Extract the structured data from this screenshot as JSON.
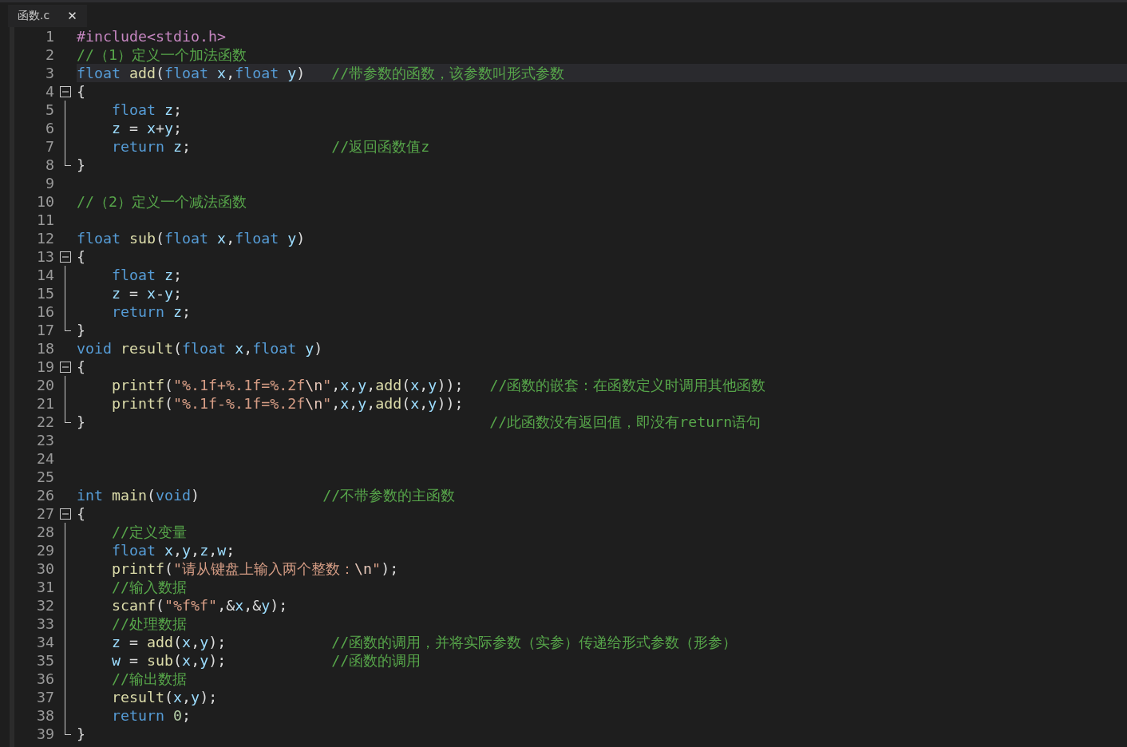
{
  "tab": {
    "title": "函数.c",
    "close": "✕"
  },
  "lines": [
    {
      "number": "1",
      "kind": "plain",
      "current": false,
      "tokens": [
        {
          "kind": "preproc",
          "text": "#include<stdio.h>"
        }
      ]
    },
    {
      "number": "2",
      "kind": "plain",
      "current": false,
      "tokens": [
        {
          "kind": "comment",
          "text": "//（1）定义一个加法函数"
        }
      ]
    },
    {
      "number": "3",
      "kind": "plain",
      "current": true,
      "tokens": [
        {
          "kind": "keyword",
          "text": "float"
        },
        {
          "kind": "func",
          "text": " add"
        },
        {
          "kind": "plain",
          "text": "("
        },
        {
          "kind": "keyword",
          "text": "float"
        },
        {
          "kind": "ident",
          "text": " x"
        },
        {
          "kind": "plain",
          "text": ","
        },
        {
          "kind": "keyword",
          "text": "float"
        },
        {
          "kind": "ident",
          "text": " y"
        },
        {
          "kind": "plain",
          "text": ")"
        },
        {
          "kind": "comment",
          "text": "   //带参数的函数，该参数叫形式参数"
        }
      ]
    },
    {
      "number": "4",
      "kind": "start",
      "current": false,
      "tokens": [
        {
          "kind": "plain",
          "text": "{"
        }
      ]
    },
    {
      "number": "5",
      "kind": "inner",
      "current": false,
      "tokens": [
        {
          "kind": "keyword",
          "text": "    float"
        },
        {
          "kind": "ident",
          "text": " z"
        },
        {
          "kind": "plain",
          "text": ";"
        }
      ]
    },
    {
      "number": "6",
      "kind": "inner",
      "current": false,
      "tokens": [
        {
          "kind": "ident",
          "text": "    z"
        },
        {
          "kind": "plain",
          "text": " = "
        },
        {
          "kind": "ident",
          "text": "x"
        },
        {
          "kind": "plain",
          "text": "+"
        },
        {
          "kind": "ident",
          "text": "y"
        },
        {
          "kind": "plain",
          "text": ";"
        }
      ]
    },
    {
      "number": "7",
      "kind": "inner",
      "current": false,
      "tokens": [
        {
          "kind": "keyword",
          "text": "    return"
        },
        {
          "kind": "ident",
          "text": " z"
        },
        {
          "kind": "plain",
          "text": ";"
        },
        {
          "kind": "comment",
          "text": "                //返回函数值z"
        }
      ]
    },
    {
      "number": "8",
      "kind": "end",
      "current": false,
      "tokens": [
        {
          "kind": "plain",
          "text": "}"
        }
      ]
    },
    {
      "number": "9",
      "kind": "plain",
      "current": false
    },
    {
      "number": "10",
      "kind": "plain",
      "current": false,
      "tokens": [
        {
          "kind": "comment",
          "text": "//（2）定义一个减法函数"
        }
      ]
    },
    {
      "number": "11",
      "kind": "plain",
      "current": false
    },
    {
      "number": "12",
      "kind": "plain",
      "current": false,
      "tokens": [
        {
          "kind": "keyword",
          "text": "float"
        },
        {
          "kind": "func",
          "text": " sub"
        },
        {
          "kind": "plain",
          "text": "("
        },
        {
          "kind": "keyword",
          "text": "float"
        },
        {
          "kind": "ident",
          "text": " x"
        },
        {
          "kind": "plain",
          "text": ","
        },
        {
          "kind": "keyword",
          "text": "float"
        },
        {
          "kind": "ident",
          "text": " y"
        },
        {
          "kind": "plain",
          "text": ")"
        }
      ]
    },
    {
      "number": "13",
      "kind": "start",
      "current": false,
      "tokens": [
        {
          "kind": "plain",
          "text": "{"
        }
      ]
    },
    {
      "number": "14",
      "kind": "inner",
      "current": false,
      "tokens": [
        {
          "kind": "keyword",
          "text": "    float"
        },
        {
          "kind": "ident",
          "text": " z"
        },
        {
          "kind": "plain",
          "text": ";"
        }
      ]
    },
    {
      "number": "15",
      "kind": "inner",
      "current": false,
      "tokens": [
        {
          "kind": "ident",
          "text": "    z"
        },
        {
          "kind": "plain",
          "text": " = "
        },
        {
          "kind": "ident",
          "text": "x"
        },
        {
          "kind": "plain",
          "text": "-"
        },
        {
          "kind": "ident",
          "text": "y"
        },
        {
          "kind": "plain",
          "text": ";"
        }
      ]
    },
    {
      "number": "16",
      "kind": "inner",
      "current": false,
      "tokens": [
        {
          "kind": "keyword",
          "text": "    return"
        },
        {
          "kind": "ident",
          "text": " z"
        },
        {
          "kind": "plain",
          "text": ";"
        }
      ]
    },
    {
      "number": "17",
      "kind": "end",
      "current": false,
      "tokens": [
        {
          "kind": "plain",
          "text": "}"
        }
      ]
    },
    {
      "number": "18",
      "kind": "plain",
      "current": false,
      "tokens": [
        {
          "kind": "keyword",
          "text": "void"
        },
        {
          "kind": "func",
          "text": " result"
        },
        {
          "kind": "plain",
          "text": "("
        },
        {
          "kind": "keyword",
          "text": "float"
        },
        {
          "kind": "ident",
          "text": " x"
        },
        {
          "kind": "plain",
          "text": ","
        },
        {
          "kind": "keyword",
          "text": "float"
        },
        {
          "kind": "ident",
          "text": " y"
        },
        {
          "kind": "plain",
          "text": ")"
        }
      ]
    },
    {
      "number": "19",
      "kind": "start",
      "current": false,
      "tokens": [
        {
          "kind": "plain",
          "text": "{"
        }
      ]
    },
    {
      "number": "20",
      "kind": "inner",
      "current": false,
      "tokens": [
        {
          "kind": "func",
          "text": "    printf"
        },
        {
          "kind": "plain",
          "text": "("
        },
        {
          "kind": "string",
          "text": "\"%.1f+%.1f=%.2f"
        },
        {
          "kind": "escape",
          "text": "\\n"
        },
        {
          "kind": "string",
          "text": "\""
        },
        {
          "kind": "plain",
          "text": ","
        },
        {
          "kind": "ident",
          "text": "x"
        },
        {
          "kind": "plain",
          "text": ","
        },
        {
          "kind": "ident",
          "text": "y"
        },
        {
          "kind": "plain",
          "text": ","
        },
        {
          "kind": "func",
          "text": "add"
        },
        {
          "kind": "plain",
          "text": "("
        },
        {
          "kind": "ident",
          "text": "x"
        },
        {
          "kind": "plain",
          "text": ","
        },
        {
          "kind": "ident",
          "text": "y"
        },
        {
          "kind": "plain",
          "text": "));"
        },
        {
          "kind": "comment",
          "text": "   //函数的嵌套：在函数定义时调用其他函数"
        }
      ]
    },
    {
      "number": "21",
      "kind": "inner",
      "current": false,
      "tokens": [
        {
          "kind": "func",
          "text": "    printf"
        },
        {
          "kind": "plain",
          "text": "("
        },
        {
          "kind": "string",
          "text": "\"%.1f-%.1f=%.2f"
        },
        {
          "kind": "escape",
          "text": "\\n"
        },
        {
          "kind": "string",
          "text": "\""
        },
        {
          "kind": "plain",
          "text": ","
        },
        {
          "kind": "ident",
          "text": "x"
        },
        {
          "kind": "plain",
          "text": ","
        },
        {
          "kind": "ident",
          "text": "y"
        },
        {
          "kind": "plain",
          "text": ","
        },
        {
          "kind": "func",
          "text": "add"
        },
        {
          "kind": "plain",
          "text": "("
        },
        {
          "kind": "ident",
          "text": "x"
        },
        {
          "kind": "plain",
          "text": ","
        },
        {
          "kind": "ident",
          "text": "y"
        },
        {
          "kind": "plain",
          "text": "));"
        }
      ]
    },
    {
      "number": "22",
      "kind": "end",
      "current": false,
      "tokens": [
        {
          "kind": "plain",
          "text": "}"
        },
        {
          "kind": "comment",
          "text": "                                              //此函数没有返回值，即没有return语句"
        }
      ]
    },
    {
      "number": "23",
      "kind": "plain",
      "current": false
    },
    {
      "number": "24",
      "kind": "plain",
      "current": false
    },
    {
      "number": "25",
      "kind": "plain",
      "current": false
    },
    {
      "number": "26",
      "kind": "plain",
      "current": false,
      "tokens": [
        {
          "kind": "keyword",
          "text": "int"
        },
        {
          "kind": "func",
          "text": " main"
        },
        {
          "kind": "plain",
          "text": "("
        },
        {
          "kind": "keyword",
          "text": "void"
        },
        {
          "kind": "plain",
          "text": ")"
        },
        {
          "kind": "comment",
          "text": "              //不带参数的主函数"
        }
      ]
    },
    {
      "number": "27",
      "kind": "start",
      "current": false,
      "tokens": [
        {
          "kind": "plain",
          "text": "{"
        }
      ]
    },
    {
      "number": "28",
      "kind": "inner",
      "current": false,
      "tokens": [
        {
          "kind": "comment",
          "text": "    //定义变量"
        }
      ]
    },
    {
      "number": "29",
      "kind": "inner",
      "current": false,
      "tokens": [
        {
          "kind": "keyword",
          "text": "    float"
        },
        {
          "kind": "ident",
          "text": " x"
        },
        {
          "kind": "plain",
          "text": ","
        },
        {
          "kind": "ident",
          "text": "y"
        },
        {
          "kind": "plain",
          "text": ","
        },
        {
          "kind": "ident",
          "text": "z"
        },
        {
          "kind": "plain",
          "text": ","
        },
        {
          "kind": "ident",
          "text": "w"
        },
        {
          "kind": "plain",
          "text": ";"
        }
      ]
    },
    {
      "number": "30",
      "kind": "inner",
      "current": false,
      "tokens": [
        {
          "kind": "func",
          "text": "    printf"
        },
        {
          "kind": "plain",
          "text": "("
        },
        {
          "kind": "string",
          "text": "\"请从键盘上输入两个整数："
        },
        {
          "kind": "escape",
          "text": "\\n"
        },
        {
          "kind": "string",
          "text": "\""
        },
        {
          "kind": "plain",
          "text": ");"
        }
      ]
    },
    {
      "number": "31",
      "kind": "inner",
      "current": false,
      "tokens": [
        {
          "kind": "comment",
          "text": "    //输入数据"
        }
      ]
    },
    {
      "number": "32",
      "kind": "inner",
      "current": false,
      "tokens": [
        {
          "kind": "func",
          "text": "    scanf"
        },
        {
          "kind": "plain",
          "text": "("
        },
        {
          "kind": "string",
          "text": "\"%f%f\""
        },
        {
          "kind": "plain",
          "text": ",&"
        },
        {
          "kind": "ident",
          "text": "x"
        },
        {
          "kind": "plain",
          "text": ",&"
        },
        {
          "kind": "ident",
          "text": "y"
        },
        {
          "kind": "plain",
          "text": ");"
        }
      ]
    },
    {
      "number": "33",
      "kind": "inner",
      "current": false,
      "tokens": [
        {
          "kind": "comment",
          "text": "    //处理数据"
        }
      ]
    },
    {
      "number": "34",
      "kind": "inner",
      "current": false,
      "tokens": [
        {
          "kind": "ident",
          "text": "    z"
        },
        {
          "kind": "plain",
          "text": " = "
        },
        {
          "kind": "func",
          "text": "add"
        },
        {
          "kind": "plain",
          "text": "("
        },
        {
          "kind": "ident",
          "text": "x"
        },
        {
          "kind": "plain",
          "text": ","
        },
        {
          "kind": "ident",
          "text": "y"
        },
        {
          "kind": "plain",
          "text": ");"
        },
        {
          "kind": "comment",
          "text": "            //函数的调用，并将实际参数（实参）传递给形式参数（形参）"
        }
      ]
    },
    {
      "number": "35",
      "kind": "inner",
      "current": false,
      "tokens": [
        {
          "kind": "ident",
          "text": "    w"
        },
        {
          "kind": "plain",
          "text": " = "
        },
        {
          "kind": "func",
          "text": "sub"
        },
        {
          "kind": "plain",
          "text": "("
        },
        {
          "kind": "ident",
          "text": "x"
        },
        {
          "kind": "plain",
          "text": ","
        },
        {
          "kind": "ident",
          "text": "y"
        },
        {
          "kind": "plain",
          "text": ");"
        },
        {
          "kind": "comment",
          "text": "            //函数的调用"
        }
      ]
    },
    {
      "number": "36",
      "kind": "inner",
      "current": false,
      "tokens": [
        {
          "kind": "comment",
          "text": "    //输出数据"
        }
      ]
    },
    {
      "number": "37",
      "kind": "inner",
      "current": false,
      "tokens": [
        {
          "kind": "func",
          "text": "    result"
        },
        {
          "kind": "plain",
          "text": "("
        },
        {
          "kind": "ident",
          "text": "x"
        },
        {
          "kind": "plain",
          "text": ","
        },
        {
          "kind": "ident",
          "text": "y"
        },
        {
          "kind": "plain",
          "text": ");"
        }
      ]
    },
    {
      "number": "38",
      "kind": "inner",
      "current": false,
      "tokens": [
        {
          "kind": "keyword",
          "text": "    return"
        },
        {
          "kind": "number",
          "text": " 0"
        },
        {
          "kind": "plain",
          "text": ";"
        }
      ]
    },
    {
      "number": "39",
      "kind": "end",
      "current": false,
      "tokens": [
        {
          "kind": "plain",
          "text": "}"
        }
      ]
    }
  ]
}
